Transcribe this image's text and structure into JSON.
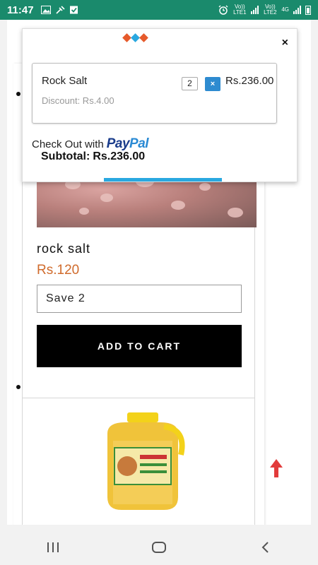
{
  "status_bar": {
    "time": "11:47",
    "network_1": "Vo)) LTE1",
    "network_2": "Vo)) LTE2",
    "network_type": "4G"
  },
  "product": {
    "name": "rock salt",
    "price": "Rs.120",
    "save_option": "Save 2",
    "add_to_cart_label": "ADD TO CART"
  },
  "cart": {
    "close_label": "×",
    "item": {
      "name": "Rock Salt",
      "discount": "Discount: Rs.4.00",
      "quantity": "2",
      "remove_label": "×",
      "price": "Rs.236.00"
    },
    "checkout_text": "Check Out with",
    "paypal_pay": "Pay",
    "paypal_pal": "Pal",
    "subtotal_label": "Subtotal:",
    "subtotal_value": "Rs.236.00"
  },
  "colors": {
    "status_bar": "#1a8a6c",
    "price_accent": "#d06b2c",
    "remove_button": "#2e8bd0",
    "popup_bar": "#29a8e0",
    "scroll_top_arrow": "#e23b3b"
  },
  "icons": {
    "status_left": [
      "image-icon",
      "tools-icon",
      "checkbox-icon"
    ],
    "status_right": [
      "alarm-icon",
      "signal-icon",
      "battery-icon"
    ],
    "nav": [
      "recent-apps-icon",
      "home-icon",
      "back-icon"
    ],
    "scroll": "scroll-to-top-icon"
  }
}
